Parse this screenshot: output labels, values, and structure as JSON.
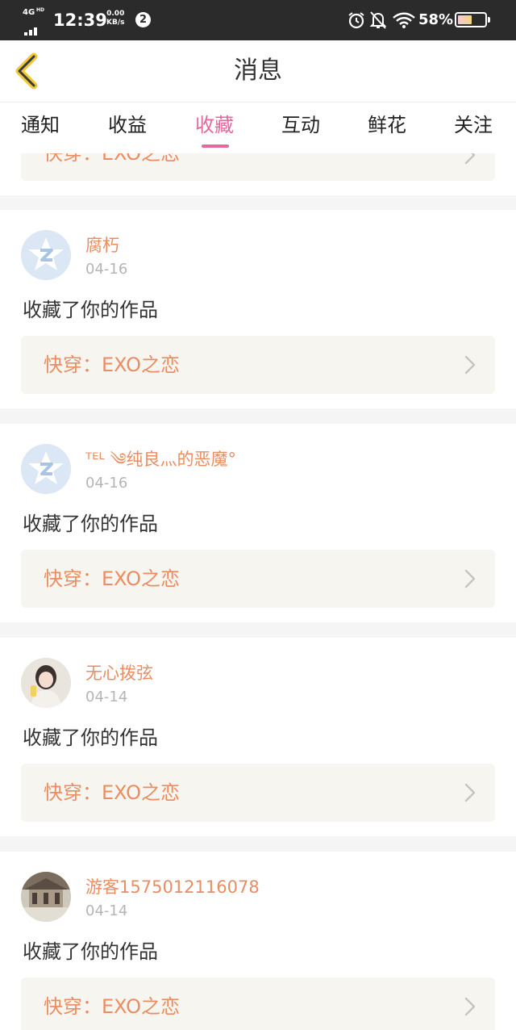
{
  "status_bar": {
    "network": "4G",
    "network_hd": "HD",
    "time": "12:39",
    "speed_value": "0.00",
    "speed_unit": "KB/s",
    "notification_count": "2",
    "battery_percent": "58%",
    "battery_level": 0.58,
    "icons": [
      "signal-icon",
      "alarm-icon",
      "mute-bell-icon",
      "wifi-icon",
      "battery-icon"
    ]
  },
  "header": {
    "title": "消息",
    "back_icon": "chevron-left-icon"
  },
  "tabs": {
    "items": [
      "通知",
      "收益",
      "收藏",
      "互动",
      "鲜花",
      "关注"
    ],
    "active_index": 2,
    "active_color": "#e6679e"
  },
  "partial_item": {
    "work_title": "快穿：EXO之恋"
  },
  "messages": [
    {
      "username": "腐朽",
      "date": "04-16",
      "action": "收藏了你的作品",
      "work_title": "快穿：EXO之恋",
      "avatar": "default-avatar-icon"
    },
    {
      "username": "ᵀᴱᴸ ༄纯良灬的恶魔°",
      "date": "04-16",
      "action": "收藏了你的作品",
      "work_title": "快穿：EXO之恋",
      "avatar": "default-avatar-icon"
    },
    {
      "username": "无心拨弦",
      "date": "04-14",
      "action": "收藏了你的作品",
      "work_title": "快穿：EXO之恋",
      "avatar": "user-photo-avatar"
    },
    {
      "username": "游客1575012116078",
      "date": "04-14",
      "action": "收藏了你的作品",
      "work_title": "快穿：EXO之恋",
      "avatar": "building-photo-avatar"
    }
  ],
  "colors": {
    "accent": "#e6679e",
    "name_orange": "#ea8d62",
    "work_box_bg": "#f6f5ef",
    "back_arrow": "#f0c838"
  }
}
